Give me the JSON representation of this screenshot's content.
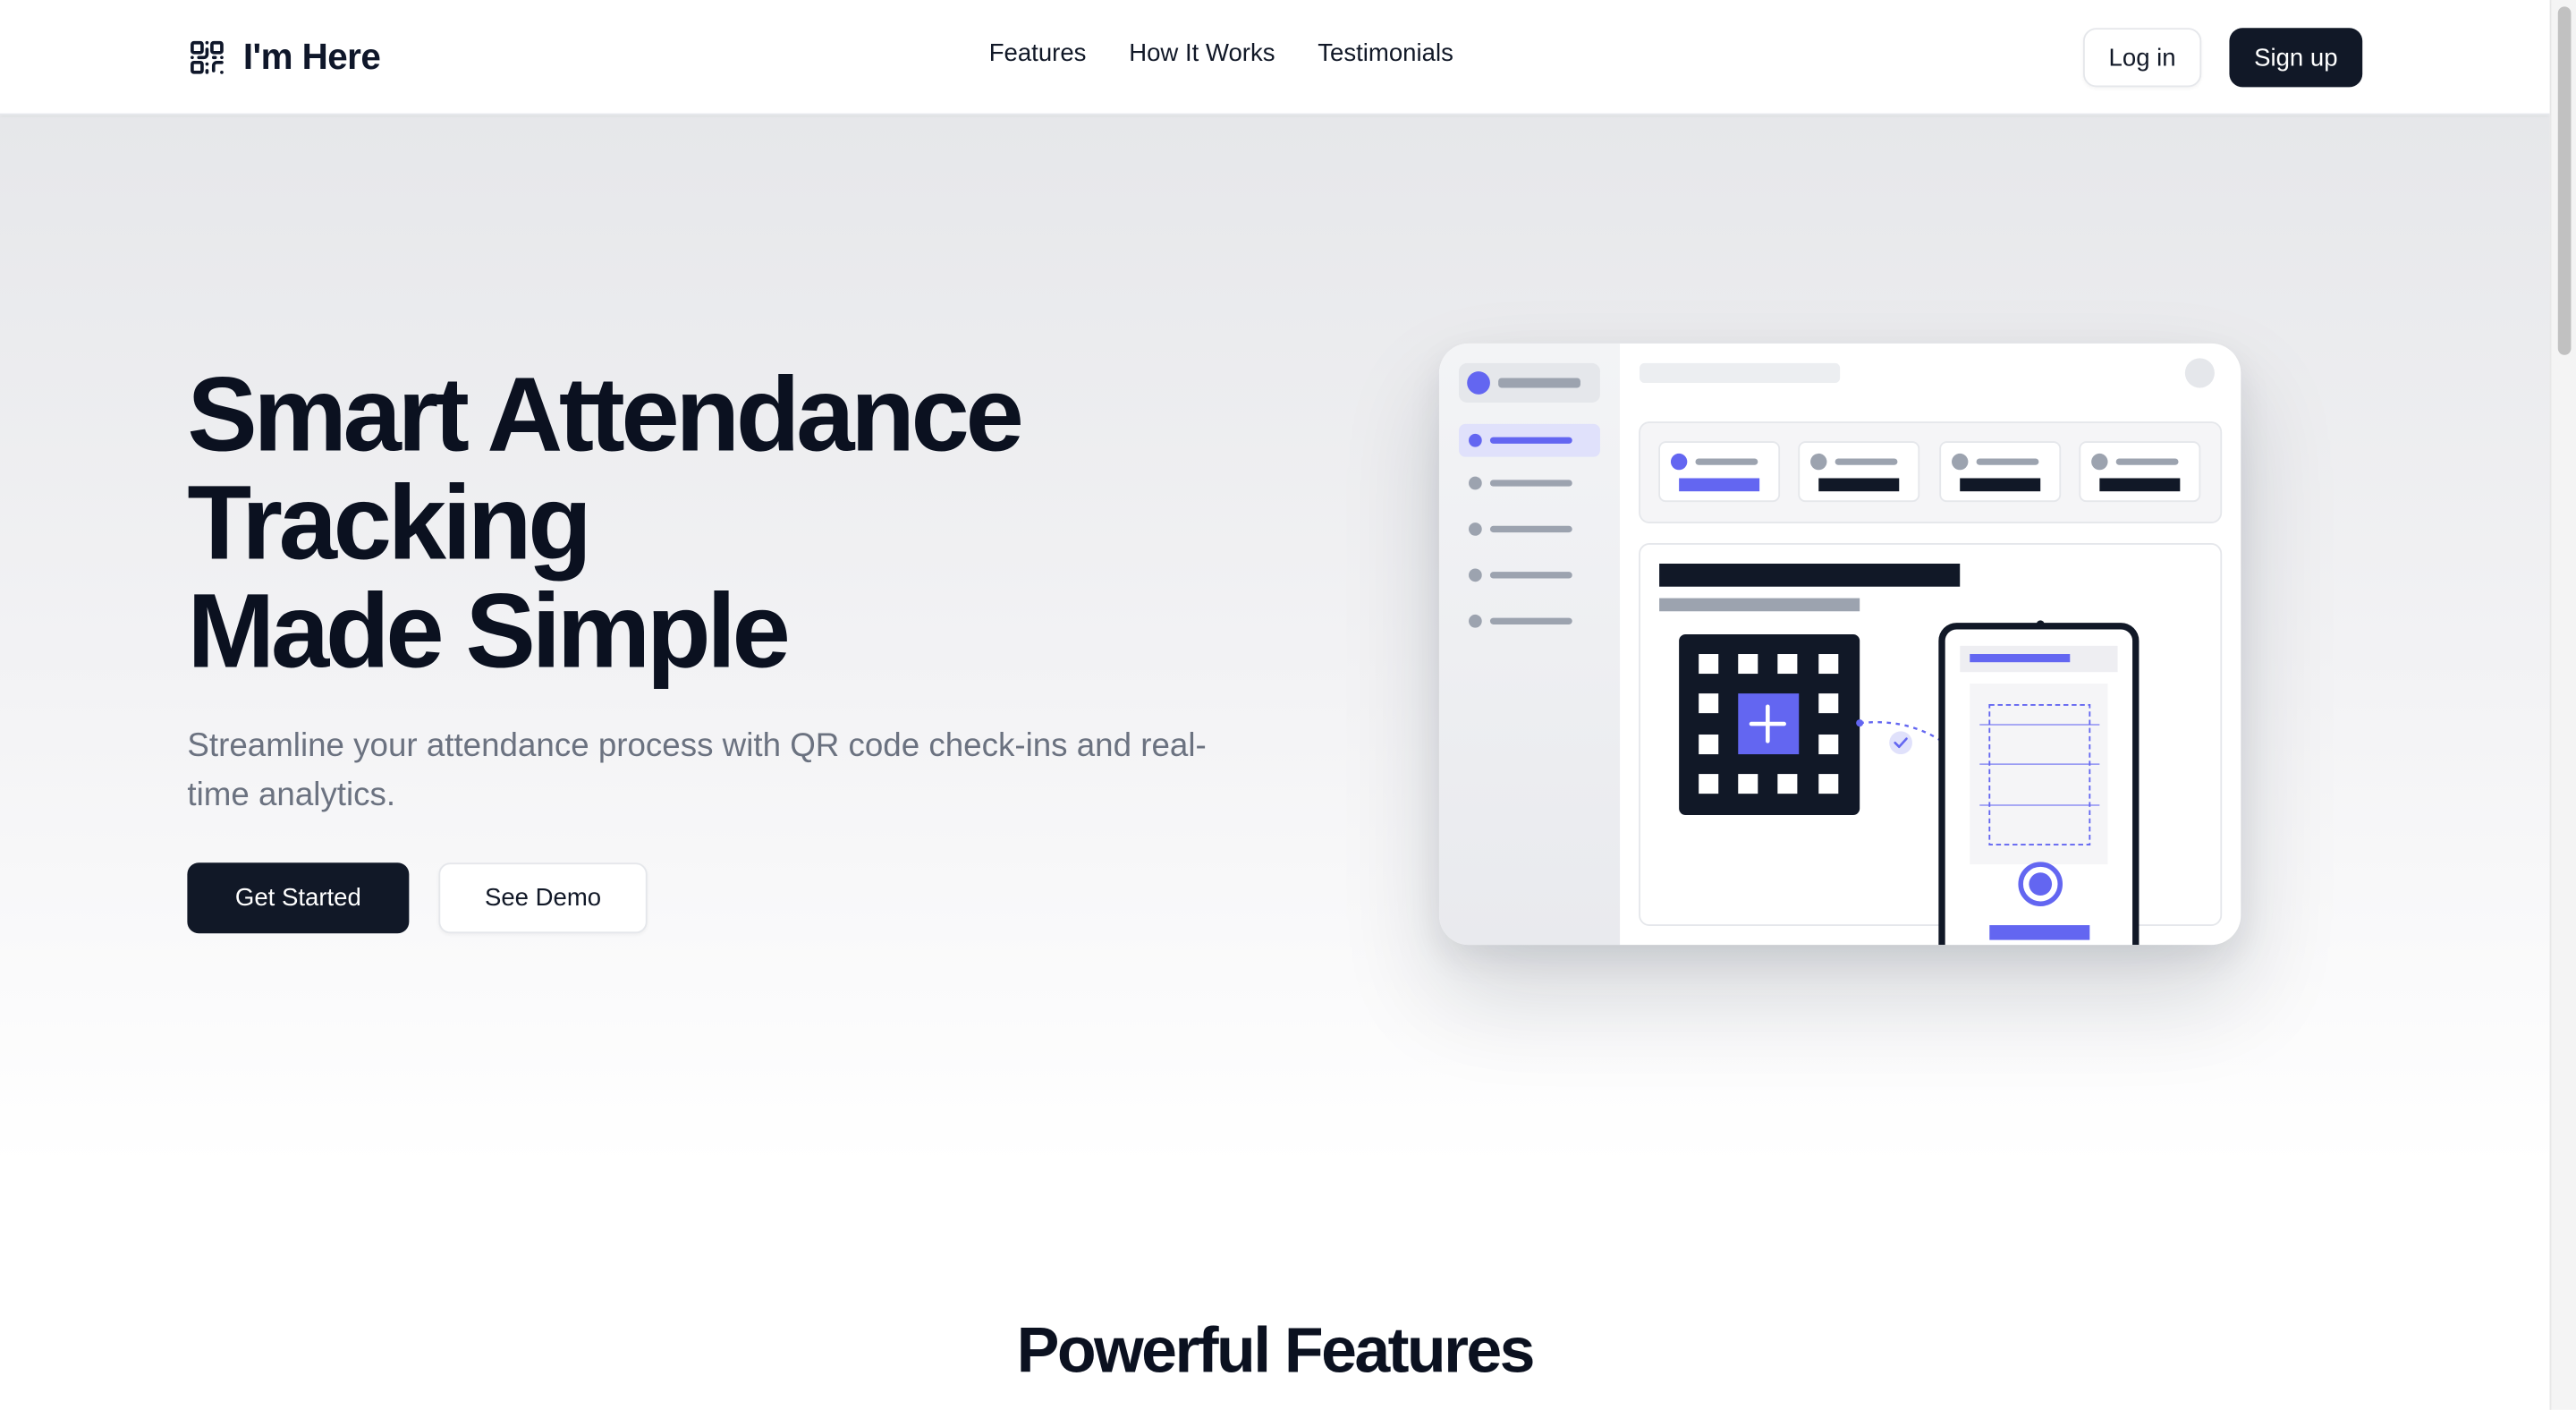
{
  "brand": {
    "name": "I'm Here",
    "icon": "qr-code-icon"
  },
  "nav": {
    "items": [
      {
        "label": "Features"
      },
      {
        "label": "How It Works"
      },
      {
        "label": "Testimonials"
      }
    ],
    "login_label": "Log in",
    "signup_label": "Sign up"
  },
  "hero": {
    "title_lines": [
      "Smart Attendance",
      "Tracking",
      "Made Simple"
    ],
    "subtitle": "Streamline your attendance process with QR code check-ins and real-time analytics.",
    "primary_cta": "Get Started",
    "secondary_cta": "See Demo"
  },
  "illustration": {
    "icon": "dashboard-illustration",
    "accent_color": "#6366f1",
    "dark_color": "#111827"
  },
  "features": {
    "heading": "Powerful Features"
  }
}
